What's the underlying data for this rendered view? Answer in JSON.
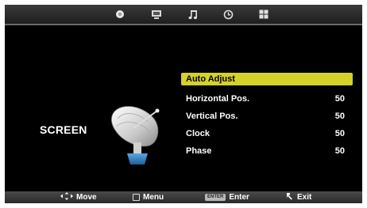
{
  "tabs": [
    {
      "icon": "picture-icon",
      "active": true
    },
    {
      "icon": "screen-icon",
      "active": false
    },
    {
      "icon": "music-note-icon",
      "active": false
    },
    {
      "icon": "clock-icon",
      "active": false
    },
    {
      "icon": "options-grid-icon",
      "active": false
    }
  ],
  "section": {
    "title": "SCREEN",
    "icon": "satellite-dish-icon"
  },
  "menu": [
    {
      "label": "Auto Adjust",
      "value": "",
      "selected": true
    },
    {
      "label": "Horizontal Pos.",
      "value": "50",
      "selected": false
    },
    {
      "label": "Vertical Pos.",
      "value": "50",
      "selected": false
    },
    {
      "label": "Clock",
      "value": "50",
      "selected": false
    },
    {
      "label": "Phase",
      "value": "50",
      "selected": false
    }
  ],
  "footer": {
    "move": {
      "icon": "move-arrows-icon",
      "label": "Move"
    },
    "menu": {
      "icon": "menu-key-icon",
      "label": "Menu"
    },
    "enter": {
      "key": "ENTER",
      "label": "Enter"
    },
    "exit": {
      "icon": "exit-arrow-icon",
      "label": "Exit"
    }
  },
  "colors": {
    "highlight": "#d5d12b",
    "background": "#000000",
    "bar": "#2a2a2a"
  }
}
